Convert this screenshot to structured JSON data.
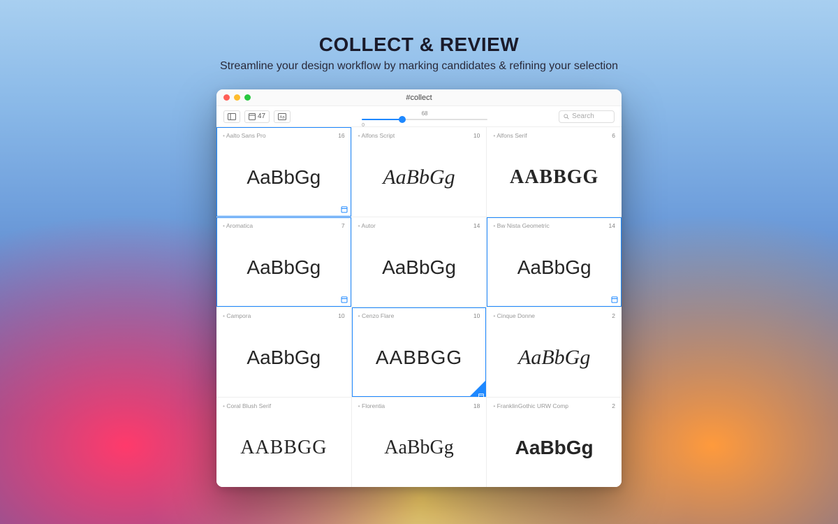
{
  "headline": {
    "title": "COLLECT & REVIEW",
    "subtitle": "Streamline your design workflow by marking candidates & refining your selection"
  },
  "window": {
    "title": "#collect"
  },
  "toolbar": {
    "count": "47",
    "slider_value": "68",
    "slider_min": "0",
    "search_placeholder": "Search"
  },
  "fonts": [
    {
      "name": "Aalto Sans Pro",
      "count": "16",
      "preview": "AaBbGg",
      "style": "f-sans",
      "sc": false,
      "selected": true,
      "marker": true,
      "active": false
    },
    {
      "name": "Alfons Script",
      "count": "10",
      "preview": "AaBbGg",
      "style": "f-script",
      "sc": false,
      "selected": false,
      "marker": false,
      "active": false
    },
    {
      "name": "Alfons Serif",
      "count": "6",
      "preview": "AABBGG",
      "style": "f-serif-caps",
      "sc": true,
      "selected": false,
      "marker": false,
      "active": false
    },
    {
      "name": "Aromatica",
      "count": "7",
      "preview": "AaBbGg",
      "style": "f-sans-thin",
      "sc": false,
      "selected": true,
      "marker": true,
      "active": false
    },
    {
      "name": "Autor",
      "count": "14",
      "preview": "AaBbGg",
      "style": "f-sans",
      "sc": false,
      "selected": false,
      "marker": false,
      "active": false
    },
    {
      "name": "Bw Nista Geometric",
      "count": "14",
      "preview": "AaBbGg",
      "style": "f-geo",
      "sc": false,
      "selected": true,
      "marker": true,
      "active": false
    },
    {
      "name": "Campora",
      "count": "10",
      "preview": "AaBbGg",
      "style": "f-sans-thin",
      "sc": false,
      "selected": false,
      "marker": false,
      "active": false
    },
    {
      "name": "Cenzo Flare",
      "count": "10",
      "preview": "AABBGG",
      "style": "f-geo",
      "sc": true,
      "selected": false,
      "marker": false,
      "active": true
    },
    {
      "name": "Cinque Donne",
      "count": "2",
      "preview": "AaBbGg",
      "style": "f-script",
      "sc": false,
      "selected": false,
      "marker": false,
      "active": false
    },
    {
      "name": "Coral Blush Serif",
      "count": "",
      "preview": "AABBGG",
      "style": "f-serif-thin",
      "sc": true,
      "selected": false,
      "marker": false,
      "active": false
    },
    {
      "name": "Florentia",
      "count": "18",
      "preview": "AaBbGg",
      "style": "f-slab",
      "sc": false,
      "selected": false,
      "marker": false,
      "active": false
    },
    {
      "name": "FranklinGothic URW Comp",
      "count": "2",
      "preview": "AaBbGg",
      "style": "f-cond",
      "sc": false,
      "selected": false,
      "marker": false,
      "active": false
    }
  ],
  "icons": {
    "sidebar": "sidebar-icon",
    "window_view": "window-icon",
    "glyph": "glyph-icon",
    "search": "search-icon",
    "marker": "bookmark-icon"
  }
}
